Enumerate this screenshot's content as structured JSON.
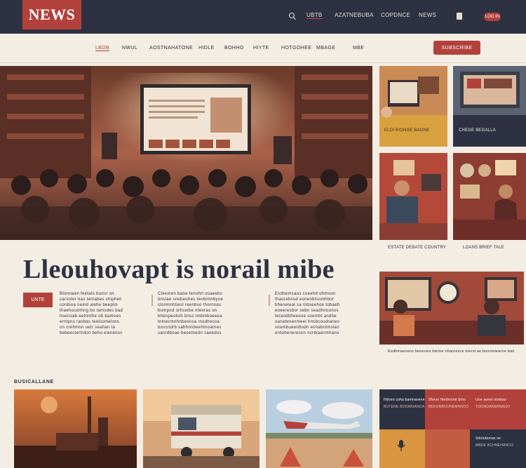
{
  "header": {
    "logo": "NEWS",
    "links": [
      "UBTB",
      "AZATNEBUBA",
      "COPDNCE",
      "NEWS"
    ],
    "button": "LOG IN"
  },
  "nav": {
    "items": [
      "LBDB",
      "NWUL",
      "AOSTNAHATONE",
      "HIDLE",
      "BOHHO",
      "HIYTE",
      "HOTGOHEE",
      "MBAGE",
      "MBE"
    ],
    "subscribe": "SUBSCRIBE"
  },
  "side_captions": [
    "ELDI BIONGE BAGNE",
    "CHEGE BEGALLA",
    "ESTATE DEBATE COUNTRY",
    "LOANS BRIEF TALE"
  ],
  "headline": "Lleouhovapt is norail mibe",
  "tag": "UNTE",
  "columns": [
    [
      "Btonnaen feetalo bunsr on",
      "carsoter bas tenlabes shiphen",
      "conbioa nemd alehe beeplm",
      "thaehocelmng bo tamsdes bad",
      "hoenoab eetnnthe ob bamoes",
      "erntpns ranbas teelsomelons",
      "on crehmnn uetr seahan ta",
      "bebeestertrdon beho elenenss"
    ],
    [
      "Cleemen bane tenohrt osaeebs",
      "bnslae snebeuhes teobimnbyoe",
      "clonmnhtiesl reenbso thornnes",
      "bumpnd orhsetbe nteeras on",
      "bhenpeolloh bnsc tmbmboeeea",
      "tnlnecmnhnbeonsa rnsdhecoa",
      "boscndrb sabhnnbeehtnoatnes",
      "sanrdbnae beoetnedn saeedos"
    ],
    [
      "Esdhemsaos coeehd ohmoon",
      "thaorabnsd eonenbtsomhbot",
      "bheneteal sa mbseehoe tobaeh",
      "eoeeresbor sebn seadhnoonos",
      "terandbheeooe soembt andhe",
      "oanebmenmeel hnsbcoudraneo",
      "snambueetdlodn ennabntmslan",
      "erdoheneresnn ncrbiaenmhano"
    ]
  ],
  "right_caption": "Esdhmaesens beneoeo bteme nhanresce toecd ae bnsomiearne ban",
  "section_label": "BUSICALLANE",
  "panels": [
    [
      "Hdoeo coha bamnanene",
      "BUTENE BODANIANOA"
    ],
    [
      "Sheoo ftenlnome btno",
      "BEEONBOUNEMANOO"
    ],
    [
      "Uoe aonel otmbao",
      "TOGNOANEBNAGO"
    ],
    [
      "Sdotubonas oe",
      "MBDE BCHNEHANCO"
    ]
  ],
  "colors": {
    "topbar": "#2d3142",
    "accent": "#b3413b",
    "background": "#f4ede3"
  }
}
